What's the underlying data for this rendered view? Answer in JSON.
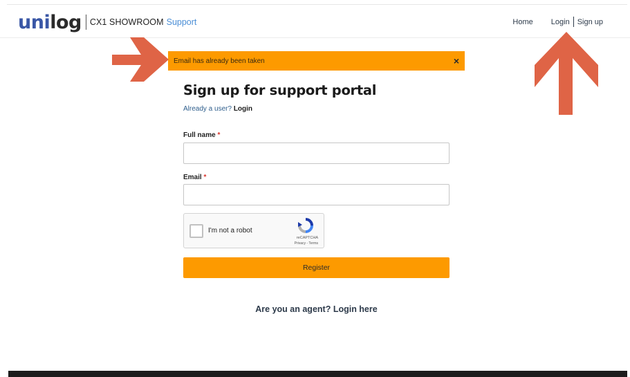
{
  "header": {
    "logo_part1": "uni",
    "logo_part2": "log",
    "product": "CX1 SHOWROOM",
    "product_sub": "Support",
    "nav": {
      "home": "Home",
      "login": "Login",
      "signup": "Sign up"
    }
  },
  "alert": {
    "message": "Email has already been taken",
    "close_icon": "×",
    "color": "#fd9a00"
  },
  "form": {
    "title": "Sign up for support portal",
    "already_user": "Already a user?",
    "login_link": "Login",
    "full_name_label": "Full name",
    "email_label": "Email",
    "required_mark": "*",
    "full_name_value": "",
    "email_value": "",
    "captcha_label": "I'm not a robot",
    "captcha_brand": "reCAPTCHA",
    "captcha_links": "Privacy - Terms",
    "register_label": "Register"
  },
  "agent": {
    "prefix": "Are you an agent?",
    "link": "Login here"
  },
  "colors": {
    "accent": "#fd9a00",
    "annotation_arrow": "#df6446",
    "brand_blue": "#3a57a6"
  },
  "icons": {
    "annotation_arrows": [
      "arrow-right-icon",
      "arrow-up-icon"
    ],
    "captcha": "recaptcha-icon"
  }
}
